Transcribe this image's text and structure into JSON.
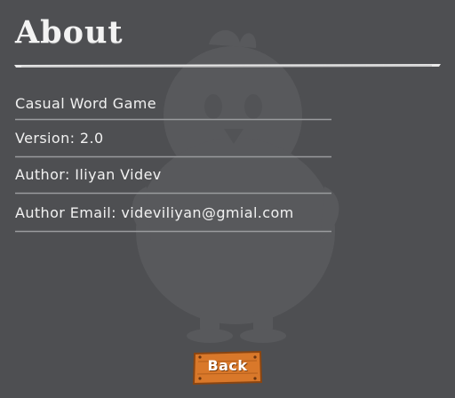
{
  "page": {
    "title": "About"
  },
  "info": {
    "game": "Casual Word Game",
    "version": "Version: 2.0",
    "author": "Author: Iliyan Videv",
    "email": "Author Email: videviliyan@gmial.com"
  },
  "actions": {
    "back_label": "Back"
  },
  "colors": {
    "background": "#4e4f52",
    "text": "#f1f1f1",
    "button_wood": "#d9782a"
  }
}
